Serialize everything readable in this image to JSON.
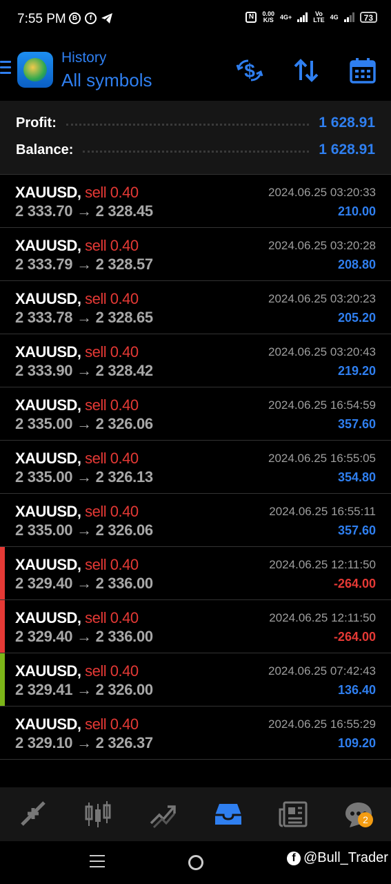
{
  "status_bar": {
    "time": "7:55 PM",
    "net_speed_value": "0.00",
    "net_speed_unit": "K/S",
    "network_1": "4G+",
    "volte_top": "Vo",
    "volte_bottom": "LTE",
    "network_2": "4G",
    "battery": "73",
    "app_icons": [
      "whatsapp-business-icon",
      "facebook-icon",
      "telegram-icon"
    ]
  },
  "header": {
    "title": "History",
    "subtitle": "All symbols",
    "icons": [
      "menu-icon",
      "metatrader-logo",
      "currency-exchange-icon",
      "sort-icon",
      "calendar-icon"
    ]
  },
  "summary": {
    "profit_label": "Profit:",
    "profit_value": "1 628.91",
    "balance_label": "Balance:",
    "balance_value": "1 628.91"
  },
  "colors": {
    "accent": "#2f7ff0",
    "sell": "#e53935",
    "positive": "#2f7ff0",
    "negative": "#e53935",
    "marker_red": "#e53935",
    "marker_green": "#7cb518"
  },
  "deals": [
    {
      "symbol": "XAUUSD,",
      "side": "sell 0.40",
      "open": "2 333.70",
      "arrow": "→",
      "close": "2 328.45",
      "time": "2024.06.25 03:20:33",
      "profit": "210.00",
      "sign": "pos",
      "marker": "none"
    },
    {
      "symbol": "XAUUSD,",
      "side": "sell 0.40",
      "open": "2 333.79",
      "arrow": "→",
      "close": "2 328.57",
      "time": "2024.06.25 03:20:28",
      "profit": "208.80",
      "sign": "pos",
      "marker": "none"
    },
    {
      "symbol": "XAUUSD,",
      "side": "sell 0.40",
      "open": "2 333.78",
      "arrow": "→",
      "close": "2 328.65",
      "time": "2024.06.25 03:20:23",
      "profit": "205.20",
      "sign": "pos",
      "marker": "none"
    },
    {
      "symbol": "XAUUSD,",
      "side": "sell 0.40",
      "open": "2 333.90",
      "arrow": "→",
      "close": "2 328.42",
      "time": "2024.06.25 03:20:43",
      "profit": "219.20",
      "sign": "pos",
      "marker": "none"
    },
    {
      "symbol": "XAUUSD,",
      "side": "sell 0.40",
      "open": "2 335.00",
      "arrow": "→",
      "close": "2 326.06",
      "time": "2024.06.25 16:54:59",
      "profit": "357.60",
      "sign": "pos",
      "marker": "none"
    },
    {
      "symbol": "XAUUSD,",
      "side": "sell 0.40",
      "open": "2 335.00",
      "arrow": "→",
      "close": "2 326.13",
      "time": "2024.06.25 16:55:05",
      "profit": "354.80",
      "sign": "pos",
      "marker": "none"
    },
    {
      "symbol": "XAUUSD,",
      "side": "sell 0.40",
      "open": "2 335.00",
      "arrow": "→",
      "close": "2 326.06",
      "time": "2024.06.25 16:55:11",
      "profit": "357.60",
      "sign": "pos",
      "marker": "none"
    },
    {
      "symbol": "XAUUSD,",
      "side": "sell 0.40",
      "open": "2 329.40",
      "arrow": "→",
      "close": "2 336.00",
      "time": "2024.06.25 12:11:50",
      "profit": "-264.00",
      "sign": "neg",
      "marker": "red"
    },
    {
      "symbol": "XAUUSD,",
      "side": "sell 0.40",
      "open": "2 329.40",
      "arrow": "→",
      "close": "2 336.00",
      "time": "2024.06.25 12:11:50",
      "profit": "-264.00",
      "sign": "neg",
      "marker": "red"
    },
    {
      "symbol": "XAUUSD,",
      "side": "sell 0.40",
      "open": "2 329.41",
      "arrow": "→",
      "close": "2 326.00",
      "time": "2024.06.25 07:42:43",
      "profit": "136.40",
      "sign": "pos",
      "marker": "green"
    },
    {
      "symbol": "XAUUSD,",
      "side": "sell 0.40",
      "open": "2 329.10",
      "arrow": "→",
      "close": "2 326.37",
      "time": "2024.06.25 16:55:29",
      "profit": "109.20",
      "sign": "pos",
      "marker": "none"
    }
  ],
  "tabbar": {
    "tabs": [
      {
        "name": "tab-quotes",
        "icon": "quotes-arrows-icon",
        "active": false
      },
      {
        "name": "tab-chart",
        "icon": "candlestick-icon",
        "active": false
      },
      {
        "name": "tab-trade",
        "icon": "trade-chart-icon",
        "active": false
      },
      {
        "name": "tab-history",
        "icon": "inbox-icon",
        "active": true
      },
      {
        "name": "tab-news",
        "icon": "newspaper-icon",
        "active": false
      },
      {
        "name": "tab-messages",
        "icon": "chat-icon",
        "active": false
      }
    ],
    "messages_badge": "2"
  },
  "system_nav": {
    "watermark": "@Bull_Trader",
    "watermark_logo": "f"
  }
}
